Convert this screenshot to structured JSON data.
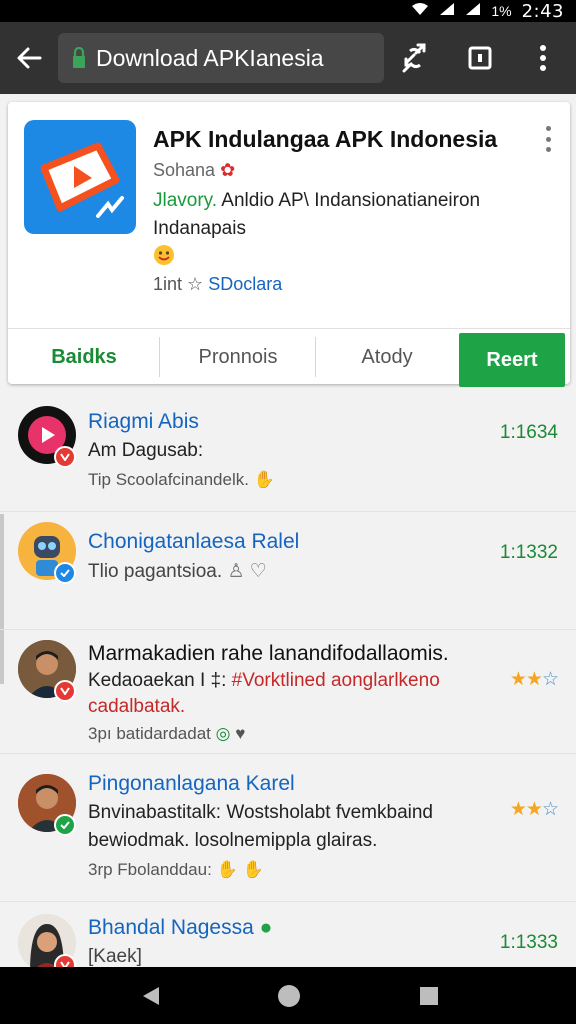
{
  "status_bar": {
    "battery": "1%",
    "time": "2:43"
  },
  "toolbar": {
    "url": "Download APKIanesia",
    "icons": [
      "back-arrow-icon",
      "lock-icon",
      "sync-icon",
      "tab-square-icon",
      "more-vert-icon"
    ]
  },
  "app": {
    "title": "APK Indulangaa APK Indonesia",
    "developer": "Sohana",
    "desc_prefix": "Jlavory.",
    "desc_line1": " Anldio AP\\ Indansionatianeiron",
    "desc_line2": "Indanapais",
    "meta_text": "1int ☆",
    "meta_link": "SDoclara",
    "actions": [
      "Baidks",
      "Pronnois",
      "Atody"
    ],
    "primary_action": "Reert",
    "accent_color": "#1ea446"
  },
  "reviews": [
    {
      "name": "Riagmi Abis",
      "line1": "Am Dagusab:",
      "meta": "Tip Scoolafcinandelk.",
      "count": "1:1634",
      "name_color": "#1565c0"
    },
    {
      "name": "Chonigatanlaesa Ralel",
      "line1": "Tlio pagantsioa.",
      "count": "1:1332",
      "name_color": "#1565c0"
    },
    {
      "name": "Marmakadien rahe lanandifodallaomis.",
      "line1_a": "Kedaoaekan I ‡:",
      "line1_b": " #Vorktlined aonglarlkeno",
      "line2": "cadalbatak.",
      "meta": "3pı batidardadat",
      "rating": 2,
      "name_color": "#111111"
    },
    {
      "name": "Pingonanlagana Karel",
      "line1": "Bnvinabastitalk: Wostsholabt fvemkbaind",
      "line2": "bewiodmak. losolnemippla glairas.",
      "meta": "3rp Fbolanddau:",
      "rating": 2,
      "name_color": "#1565c0"
    },
    {
      "name": "Bhandal Nagessa",
      "line1": "Kaek",
      "count": "1:1333",
      "name_color": "#1565c0"
    }
  ]
}
